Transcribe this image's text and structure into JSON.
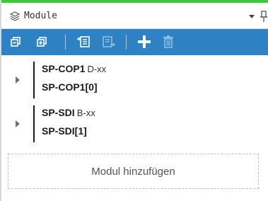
{
  "panel": {
    "title": "Module",
    "title_icon": "module-stack-icon",
    "dropdown_icon": "chevron-down-icon",
    "pin_icon": "pin-icon"
  },
  "colors": {
    "accent_top": "#3cc83c",
    "toolbar_bg": "#2e82c3",
    "toolbar_icon": "#ffffff",
    "toolbar_icon_disabled": "#8fbde2"
  },
  "toolbar": {
    "buttons": [
      {
        "icon": "collapse-all-icon",
        "enabled": true
      },
      {
        "icon": "expand-all-icon",
        "enabled": true
      },
      {
        "icon": "import-icon",
        "enabled": true
      },
      {
        "icon": "export-icon",
        "enabled": false
      },
      {
        "icon": "add-icon",
        "enabled": true
      },
      {
        "icon": "delete-icon",
        "enabled": false
      }
    ]
  },
  "modules": [
    {
      "name": "SP-COP1",
      "type": "D-xx",
      "instance": "SP-COP1[0]",
      "expand_icon": "chevron-right-icon"
    },
    {
      "name": "SP-SDI",
      "type": "B-xx",
      "instance": "SP-SDI[1]",
      "expand_icon": "chevron-right-icon"
    }
  ],
  "add_module": {
    "label": "Modul hinzufügen"
  }
}
